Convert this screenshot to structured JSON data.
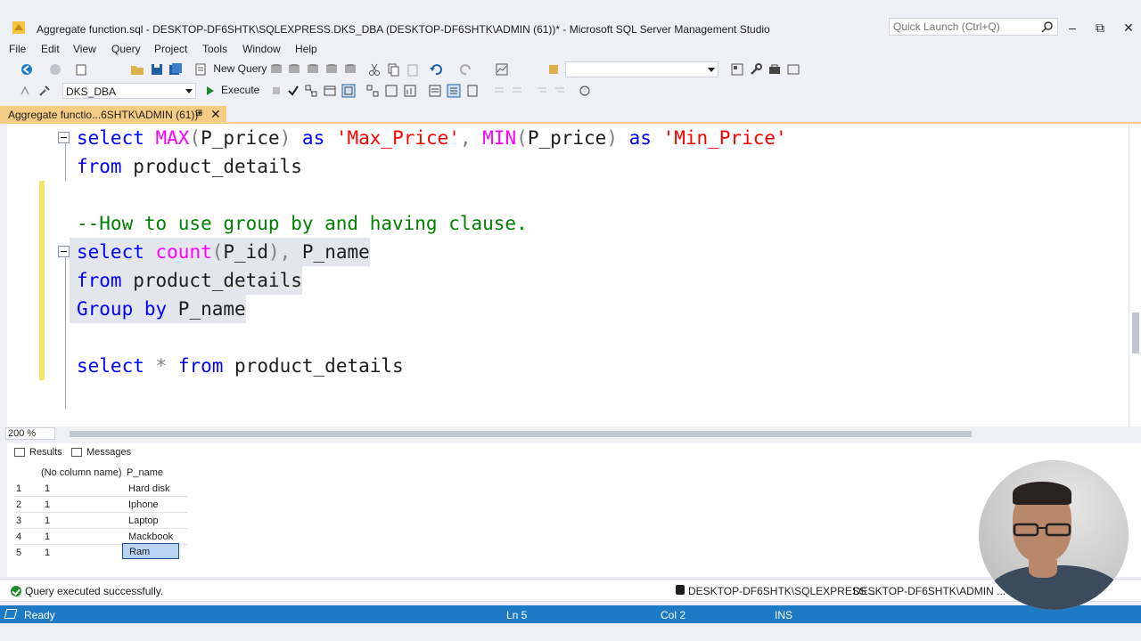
{
  "window": {
    "title": "Aggregate function.sql - DESKTOP-DF6SHTK\\SQLEXPRESS.DKS_DBA (DESKTOP-DF6SHTK\\ADMIN (61))* - Microsoft SQL Server Management Studio",
    "quick_launch_placeholder": "Quick Launch (Ctrl+Q)"
  },
  "menu": [
    "File",
    "Edit",
    "View",
    "Query",
    "Project",
    "Tools",
    "Window",
    "Help"
  ],
  "toolbar": {
    "new_query_label": "New Query",
    "database": "DKS_DBA",
    "execute_label": "Execute"
  },
  "document_tab": {
    "label": "Aggregate functio...6SHTK\\ADMIN (61))*"
  },
  "editor": {
    "lines": [
      {
        "tokens": [
          {
            "t": "select ",
            "c": "kw"
          },
          {
            "t": "MAX",
            "c": "fn"
          },
          {
            "t": "(",
            "c": "gray"
          },
          {
            "t": "P_price",
            "c": "plain"
          },
          {
            "t": ") ",
            "c": "gray"
          },
          {
            "t": "as ",
            "c": "kw"
          },
          {
            "t": "'Max_Price'",
            "c": "str"
          },
          {
            "t": ", ",
            "c": "gray"
          },
          {
            "t": "MIN",
            "c": "fn"
          },
          {
            "t": "(",
            "c": "gray"
          },
          {
            "t": "P_price",
            "c": "plain"
          },
          {
            "t": ") ",
            "c": "gray"
          },
          {
            "t": "as ",
            "c": "kw"
          },
          {
            "t": "'Min_Price'",
            "c": "str"
          }
        ]
      },
      {
        "tokens": [
          {
            "t": "from ",
            "c": "kw"
          },
          {
            "t": "product_details",
            "c": "plain"
          }
        ]
      },
      {
        "tokens": []
      },
      {
        "tokens": [
          {
            "t": "--How to use group by and having clause.",
            "c": "cm"
          }
        ]
      },
      {
        "tokens": [
          {
            "t": "select ",
            "c": "kw"
          },
          {
            "t": "count",
            "c": "fn"
          },
          {
            "t": "(",
            "c": "gray"
          },
          {
            "t": "P_id",
            "c": "plain"
          },
          {
            "t": "), ",
            "c": "gray"
          },
          {
            "t": "P_name",
            "c": "plain"
          }
        ]
      },
      {
        "tokens": [
          {
            "t": "from ",
            "c": "kw"
          },
          {
            "t": "product_details",
            "c": "plain"
          }
        ]
      },
      {
        "tokens": [
          {
            "t": "Group by ",
            "c": "kw"
          },
          {
            "t": "P_name",
            "c": "plain"
          }
        ]
      },
      {
        "tokens": []
      },
      {
        "tokens": [
          {
            "t": "select ",
            "c": "kw"
          },
          {
            "t": "* ",
            "c": "gray"
          },
          {
            "t": "from ",
            "c": "kw"
          },
          {
            "t": "product_details",
            "c": "plain"
          }
        ]
      }
    ],
    "zoom": "200 %"
  },
  "results": {
    "tabs": [
      "Results",
      "Messages"
    ],
    "columns": [
      "(No column name)",
      "P_name"
    ],
    "rows": [
      {
        "num": "1",
        "count": "1",
        "name": "Hard disk"
      },
      {
        "num": "2",
        "count": "1",
        "name": "Iphone"
      },
      {
        "num": "3",
        "count": "1",
        "name": "Laptop"
      },
      {
        "num": "4",
        "count": "1",
        "name": "Mackbook"
      },
      {
        "num": "5",
        "count": "1",
        "name": "Ram"
      }
    ]
  },
  "query_status": {
    "message": "Query executed successfully.",
    "server": "DESKTOP-DF6SHTK\\SQLEXPRESS ...",
    "user": "DESKTOP-DF6SHTK\\ADMIN ..."
  },
  "statusbar": {
    "ready": "Ready",
    "line": "Ln 5",
    "col": "Col 2",
    "mode": "INS"
  },
  "colors": {
    "accent": "#1e7ac4",
    "tab_active": "#f5cc84",
    "keyword": "#0000ff",
    "function": "#ff00ff",
    "string": "#ff0000",
    "comment": "#008000"
  }
}
